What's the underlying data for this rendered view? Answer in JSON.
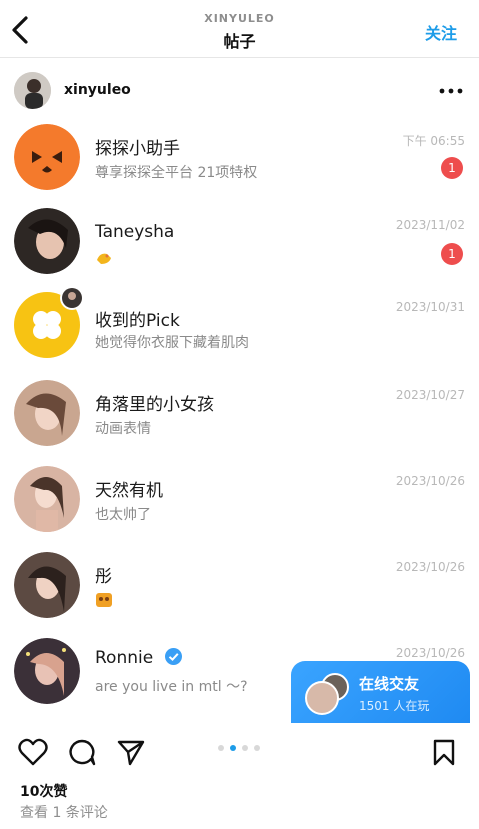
{
  "header": {
    "username": "XINYULEO",
    "title": "帖子",
    "follow_label": "关注"
  },
  "post": {
    "author": "xinyuleo",
    "likes": "10次赞",
    "comments_link": "查看 1 条评论",
    "carousel": {
      "total": 4,
      "active": 2
    }
  },
  "chat_list": [
    {
      "name": "探探小助手",
      "preview": "尊享探探全平台 21项特权",
      "time": "下午 06:55",
      "unread": "1",
      "avatar_color": "#f47a2c"
    },
    {
      "name": "Taneysha",
      "preview": "",
      "time": "2023/11/02",
      "unread": "1",
      "avatar_color": "#2d2724"
    },
    {
      "name": "收到的Pick",
      "preview": "她觉得你衣服下藏着肌肉",
      "time": "2023/10/31",
      "unread": "",
      "avatar_color": "#f7c313"
    },
    {
      "name": "角落里的小女孩",
      "preview": "动画表情",
      "time": "2023/10/27",
      "unread": "",
      "avatar_color": "#c9a690"
    },
    {
      "name": "天然有机",
      "preview": "也太帅了",
      "time": "2023/10/26",
      "unread": "",
      "avatar_color": "#d8b4a3"
    },
    {
      "name": "彤",
      "preview": "",
      "time": "2023/10/26",
      "unread": "",
      "avatar_color": "#5c4a42"
    },
    {
      "name": "Ronnie",
      "preview": "are you live in mtl ～?",
      "time": "2023/10/26",
      "unread": "",
      "avatar_color": "#3b3038"
    }
  ],
  "online_pill": {
    "title": "在线交友",
    "subtitle": "1501 人在玩"
  },
  "colors": {
    "accent": "#1d9ce8",
    "badge": "#ee4d4d",
    "pill": "#2f97f9"
  }
}
